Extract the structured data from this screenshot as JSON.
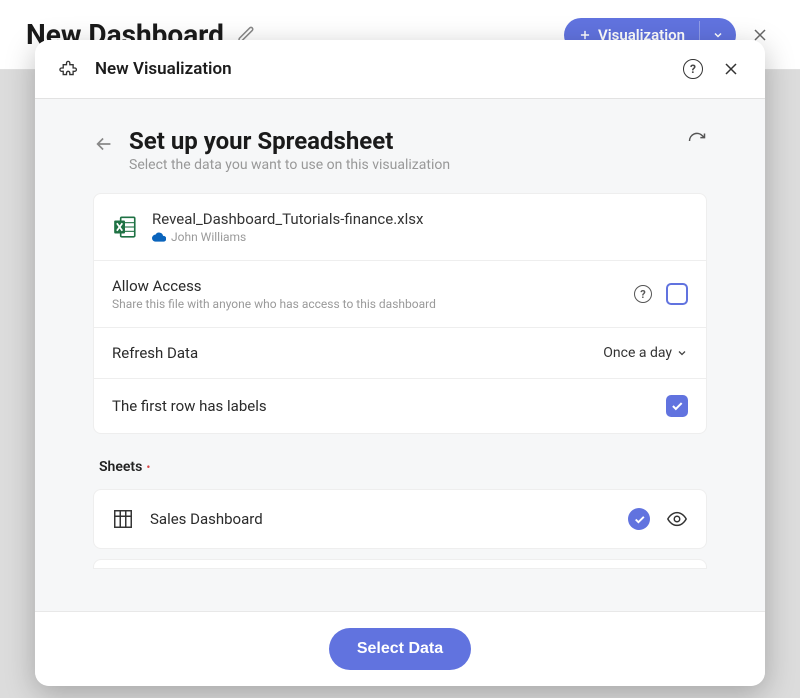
{
  "bg": {
    "title": "New Dashboard",
    "visButton": "Visualization"
  },
  "modal": {
    "header": {
      "title": "New Visualization"
    },
    "body": {
      "title": "Set up your Spreadsheet",
      "subtitle": "Select the data you want to use on this visualization",
      "file": {
        "name": "Reveal_Dashboard_Tutorials-finance.xlsx",
        "owner": "John Williams"
      },
      "access": {
        "title": "Allow Access",
        "subtitle": "Share this file with anyone who has access to this dashboard",
        "checked": false
      },
      "refresh": {
        "label": "Refresh Data",
        "value": "Once a day"
      },
      "labelsRow": {
        "label": "The first row has labels",
        "checked": true
      },
      "sheets": {
        "title": "Sheets",
        "items": [
          {
            "name": "Sales Dashboard",
            "selected": true
          }
        ]
      }
    },
    "footer": {
      "selectData": "Select Data"
    }
  }
}
